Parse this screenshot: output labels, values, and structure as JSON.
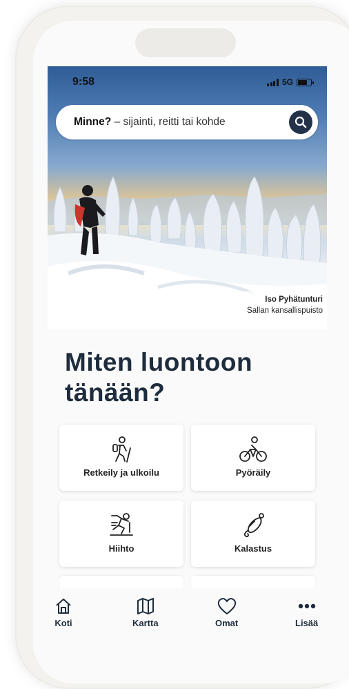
{
  "status": {
    "time": "9:58",
    "network": "5G"
  },
  "search": {
    "label": "Minne?",
    "placeholder": "– sijainti, reitti tai kohde"
  },
  "hero": {
    "location": "Iso Pyhätunturi",
    "park": "Sallan kansallispuisto"
  },
  "heading": {
    "line1": "Miten luontoon",
    "line2": "tänään?"
  },
  "activities": [
    {
      "label": "Retkeily ja ulkoilu",
      "icon": "hiker-icon"
    },
    {
      "label": "Pyöräily",
      "icon": "cyclist-icon"
    },
    {
      "label": "Hiihto",
      "icon": "skier-icon"
    },
    {
      "label": "Kalastus",
      "icon": "fishing-lure-icon"
    }
  ],
  "nav": [
    {
      "label": "Koti",
      "icon": "home-icon"
    },
    {
      "label": "Kartta",
      "icon": "map-icon"
    },
    {
      "label": "Omat",
      "icon": "heart-icon"
    },
    {
      "label": "Lisää",
      "icon": "more-icon"
    }
  ],
  "colors": {
    "brand_dark": "#1e2c3d",
    "search_button": "#23324a",
    "frame": "#f3f2ef"
  }
}
